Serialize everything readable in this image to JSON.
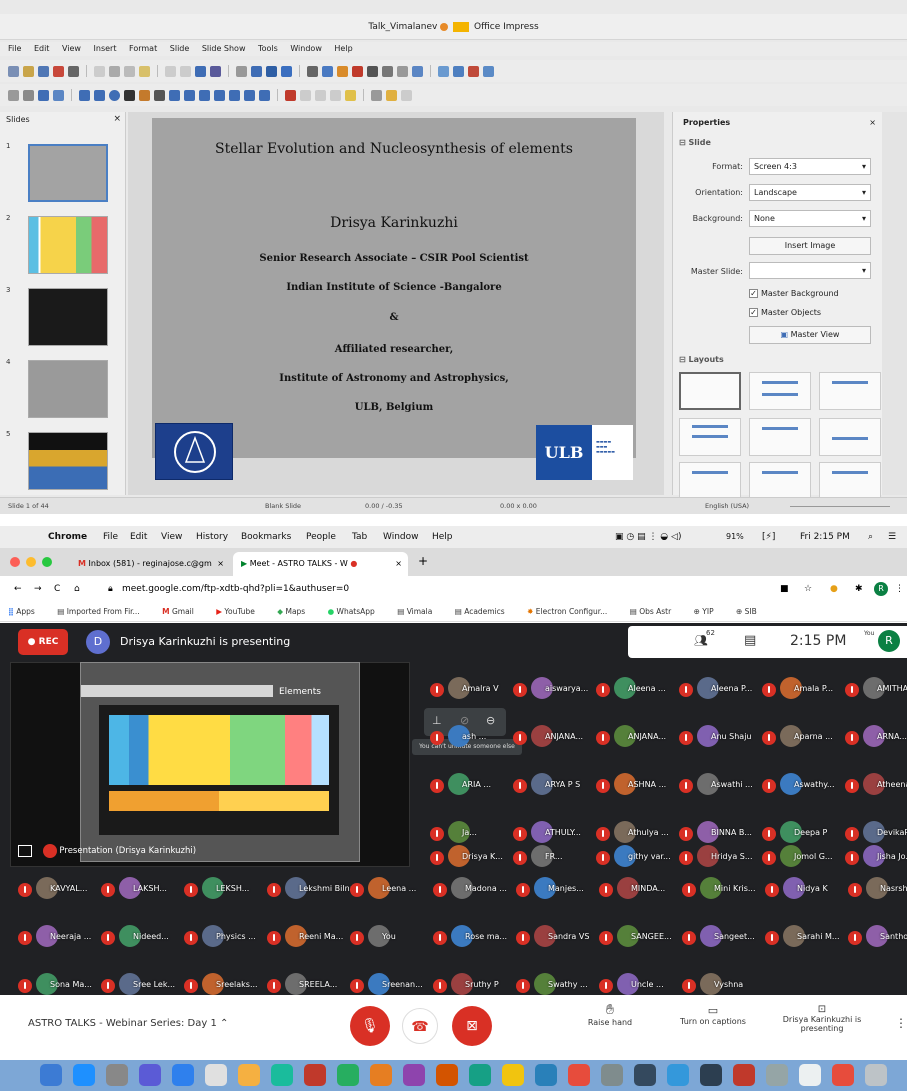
{
  "impress": {
    "title": "Talk_Vimalanev",
    "title_suffix": "Office Impress",
    "menu": [
      "File",
      "Edit",
      "View",
      "Insert",
      "Format",
      "Slide",
      "Slide Show",
      "Tools",
      "Window",
      "Help"
    ],
    "slides_pane_title": "Slides",
    "slide_numbers": [
      "1",
      "2",
      "3",
      "4",
      "5"
    ],
    "slide": {
      "title": "Stellar Evolution and Nucleosynthesis of elements",
      "presenter": "Drisya Karinkuzhi",
      "lines": [
        "Senior Research Associate – CSIR Pool Scientist",
        "Indian Institute of Science -Bangalore",
        "&",
        "Affiliated researcher,",
        "Institute of Astronomy and Astrophysics,",
        "ULB, Belgium"
      ],
      "ulb_logo_text": "ULB"
    },
    "properties": {
      "title": "Properties",
      "slide_section": "Slide",
      "format_label": "Format:",
      "format_value": "Screen 4:3",
      "orientation_label": "Orientation:",
      "orientation_value": "Landscape",
      "background_label": "Background:",
      "background_value": "None",
      "insert_image": "Insert Image",
      "master_slide_label": "Master Slide:",
      "master_background": "Master Background",
      "master_objects": "Master Objects",
      "master_view": "Master View",
      "layouts_section": "Layouts"
    },
    "status": {
      "slide_count": "Slide 1 of 44",
      "layout": "Blank Slide",
      "position": "0.00 / -0.35",
      "size": "0.00 x 0.00",
      "language": "English (USA)"
    }
  },
  "mac_menubar": {
    "app": "Chrome",
    "items": [
      "File",
      "Edit",
      "View",
      "History",
      "Bookmarks",
      "People",
      "Tab",
      "Window",
      "Help"
    ],
    "battery": "91%",
    "clock": "Fri 2:15 PM"
  },
  "browser": {
    "tabs": [
      {
        "label": "Inbox (581) - reginajose.c@gm",
        "icon": "gmail-icon"
      },
      {
        "label": "Meet - ASTRO TALKS - W",
        "icon": "meet-icon"
      }
    ],
    "url": "meet.google.com/ftp-xdtb-qhd?pli=1&authuser=0",
    "bookmarks": [
      "Apps",
      "Imported From Fir...",
      "Gmail",
      "YouTube",
      "Maps",
      "WhatsApp",
      "Vimala",
      "Academics",
      "Electron Configur...",
      "Obs Astr",
      "YIP",
      "SIB"
    ]
  },
  "meet": {
    "rec_label": "REC",
    "presenter_initial": "D",
    "presenting_text": "Drisya Karinkuzhi is presenting",
    "participant_count": "62",
    "time": "2:15 PM",
    "you_label": "You",
    "you_initial": "R",
    "presentation_caption": "Presentation (Drisya Karinkuzhi)",
    "shared_slide_title": "Elements",
    "tooltip": "You can't unmute someone else",
    "participants": [
      "Amalra V",
      "aiswarya...",
      "Aleena ...",
      "Aleena P...",
      "Amala P...",
      "AMITHA...",
      "ash ...",
      "ANJANA...",
      "ANJANA...",
      "Anu Shaju",
      "Aparna ...",
      "ARNA...",
      "ARIA ...",
      "ARYA P S",
      "ASHNA ...",
      "Aswathi ...",
      "Aswathy...",
      "Atheena ...",
      "Ja...",
      "ATHULY...",
      "Athulya ...",
      "BINNA B...",
      "Deepa P",
      "DevikaR...",
      "Drisya K...",
      "FR...",
      "githy var...",
      "Hridya S...",
      "Jomol G...",
      "Jisha Jo...",
      "KAVYAL...",
      "LAKSH...",
      "LEKSH...",
      "Lekshmi Bilna...",
      "Leena ...",
      "Madona ...",
      "Manjes...",
      "MINDA...",
      "Mini Kris...",
      "Nidya K",
      "Nasrshee...",
      "Neeraja ...",
      "Nideed...",
      "Physics ...",
      "Reeni Ma...",
      "You",
      "Rose ma...",
      "Sandra VS",
      "SANGEE...",
      "Sangeet...",
      "Sarahi M...",
      "Santhos...",
      "Sona Ma...",
      "Sree Lek...",
      "Sreelaks...",
      "SREELA...",
      "Sreenan...",
      "Sruthy P",
      "Swathy ...",
      "Uncle ...",
      "Vyshna"
    ],
    "meeting_title": "ASTRO TALKS - Webinar Series: Day 1",
    "raise_hand": "Raise hand",
    "captions": "Turn on captions",
    "presenting_status": "Drisya Karinkuzhi is presenting"
  }
}
